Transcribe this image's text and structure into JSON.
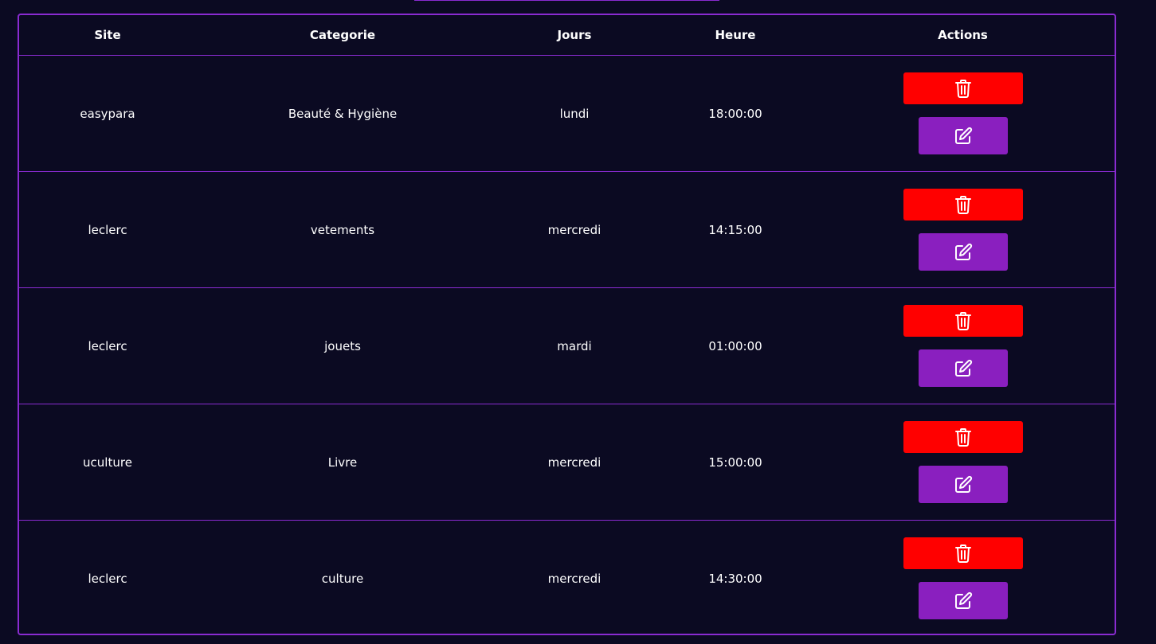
{
  "table": {
    "headers": {
      "site": "Site",
      "categorie": "Categorie",
      "jours": "Jours",
      "heure": "Heure",
      "actions": "Actions"
    },
    "rows": [
      {
        "site": "easypara",
        "categorie": "Beauté & Hygiène",
        "jours": "lundi",
        "heure": "18:00:00"
      },
      {
        "site": "leclerc",
        "categorie": "vetements",
        "jours": "mercredi",
        "heure": "14:15:00"
      },
      {
        "site": "leclerc",
        "categorie": "jouets",
        "jours": "mardi",
        "heure": "01:00:00"
      },
      {
        "site": "uculture",
        "categorie": "Livre",
        "jours": "mercredi",
        "heure": "15:00:00"
      },
      {
        "site": "leclerc",
        "categorie": "culture",
        "jours": "mercredi",
        "heure": "14:30:00"
      }
    ]
  },
  "icons": {
    "delete": "trash-icon",
    "edit": "edit-icon"
  },
  "colors": {
    "background": "#0b0a22",
    "border": "#8a2bd1",
    "delete_button": "#ff0000",
    "edit_button": "#8a1fbf",
    "text": "#ffffff"
  }
}
